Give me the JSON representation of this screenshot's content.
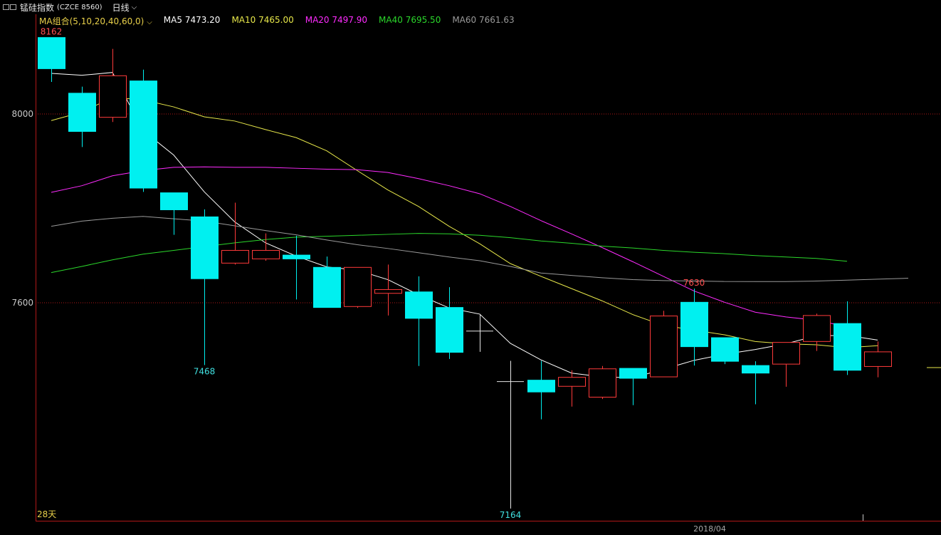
{
  "header": {
    "instrument": "锰硅指数",
    "code": "(CZCE 8560)",
    "period": "日线",
    "ma_group_label": "MA组合(5,10,20,40,60,0)",
    "ma_values": [
      {
        "name": "MA5",
        "value": "7473.20",
        "color": "#ffffff"
      },
      {
        "name": "MA10",
        "value": "7465.00",
        "color": "#e8e84a"
      },
      {
        "name": "MA20",
        "value": "7497.90",
        "color": "#ff2bff"
      },
      {
        "name": "MA40",
        "value": "7695.50",
        "color": "#2bd82b"
      },
      {
        "name": "MA60",
        "value": "7661.63",
        "color": "#9a9a9a"
      }
    ]
  },
  "footer": {
    "days_label": "28天",
    "date_label": "2018/04"
  },
  "colors": {
    "up": "#ff3a3a",
    "down": "#00f0f0",
    "grid": "#b01818",
    "axis": "#b01818"
  },
  "chart_data": {
    "type": "candlestick",
    "ylim": [
      7160,
      8260
    ],
    "yticks": [
      8000,
      7600
    ],
    "annotations": [
      {
        "text": "8162",
        "index": 0,
        "price": 8162,
        "color": "#ff5050",
        "pos": "above"
      },
      {
        "text": "7468",
        "index": 5,
        "price": 7468,
        "color": "#40e0e0",
        "pos": "below"
      },
      {
        "text": "7164",
        "index": 15,
        "price": 7164,
        "color": "#40e0e0",
        "pos": "below"
      },
      {
        "text": "7630",
        "index": 21,
        "price": 7630,
        "color": "#ff5050",
        "pos": "above"
      }
    ],
    "candles": [
      {
        "o": 8162,
        "h": 8162,
        "l": 8068,
        "c": 8096
      },
      {
        "o": 8044,
        "h": 8058,
        "l": 7930,
        "c": 7963
      },
      {
        "o": 7993,
        "h": 8138,
        "l": 7983,
        "c": 8081
      },
      {
        "o": 8070,
        "h": 8094,
        "l": 7835,
        "c": 7843
      },
      {
        "o": 7833,
        "h": 7808,
        "l": 7744,
        "c": 7797
      },
      {
        "o": 7782,
        "h": 7798,
        "l": 7468,
        "c": 7651
      },
      {
        "o": 7684,
        "h": 7812,
        "l": 7681,
        "c": 7711
      },
      {
        "o": 7693,
        "h": 7747,
        "l": 7689,
        "c": 7711
      },
      {
        "o": 7701,
        "h": 7742,
        "l": 7607,
        "c": 7693
      },
      {
        "o": 7675,
        "h": 7698,
        "l": 7590,
        "c": 7590
      },
      {
        "o": 7592,
        "h": 7675,
        "l": 7589,
        "c": 7675
      },
      {
        "o": 7620,
        "h": 7681,
        "l": 7573,
        "c": 7628
      },
      {
        "o": 7623,
        "h": 7656,
        "l": 7466,
        "c": 7567
      },
      {
        "o": 7590,
        "h": 7633,
        "l": 7481,
        "c": 7495
      },
      {
        "o": 7540,
        "h": 7575,
        "l": 7496,
        "c": 7540
      },
      {
        "o": 7433,
        "h": 7477,
        "l": 7164,
        "c": 7433
      },
      {
        "o": 7436,
        "h": 7477,
        "l": 7353,
        "c": 7411
      },
      {
        "o": 7423,
        "h": 7457,
        "l": 7380,
        "c": 7442
      },
      {
        "o": 7400,
        "h": 7466,
        "l": 7396,
        "c": 7460
      },
      {
        "o": 7461,
        "h": 7459,
        "l": 7383,
        "c": 7440
      },
      {
        "o": 7443,
        "h": 7583,
        "l": 7443,
        "c": 7572
      },
      {
        "o": 7601,
        "h": 7630,
        "l": 7467,
        "c": 7507
      },
      {
        "o": 7526,
        "h": 7523,
        "l": 7470,
        "c": 7476
      },
      {
        "o": 7467,
        "h": 7476,
        "l": 7385,
        "c": 7451
      },
      {
        "o": 7470,
        "h": 7515,
        "l": 7422,
        "c": 7516
      },
      {
        "o": 7518,
        "h": 7577,
        "l": 7498,
        "c": 7573
      },
      {
        "o": 7556,
        "h": 7603,
        "l": 7447,
        "c": 7457
      },
      {
        "o": 7465,
        "h": 7518,
        "l": 7442,
        "c": 7496
      }
    ],
    "series": [
      {
        "name": "MA5",
        "color": "#ffffff",
        "values": [
          8086,
          8082,
          8088,
          7965,
          7913,
          7835,
          7771,
          7727,
          7699,
          7676,
          7669,
          7649,
          7617,
          7589,
          7576,
          7514,
          7479,
          7451,
          7443,
          7441,
          7459,
          7478,
          7491,
          7501,
          7513,
          7530,
          7531,
          7521
        ]
      },
      {
        "name": "MA10",
        "color": "#e8e84a",
        "values": [
          7986,
          8004,
          8035,
          8030,
          8015,
          7994,
          7985,
          7967,
          7950,
          7922,
          7880,
          7839,
          7804,
          7762,
          7725,
          7683,
          7656,
          7630,
          7604,
          7575,
          7552,
          7542,
          7532,
          7518,
          7513,
          7511,
          7505,
          7509
        ]
      },
      {
        "name": "MA20",
        "color": "#ff2bff",
        "values": [
          7834,
          7848,
          7869,
          7880,
          7887,
          7888,
          7887,
          7887,
          7885,
          7883,
          7882,
          7876,
          7863,
          7848,
          7831,
          7804,
          7774,
          7746,
          7717,
          7687,
          7656,
          7625,
          7601,
          7580,
          7570,
          7563,
          7549
        ]
      },
      {
        "name": "MA40",
        "color": "#2bd82b",
        "values": [
          7664,
          7677,
          7691,
          7703,
          7711,
          7719,
          7727,
          7734,
          7739,
          7741,
          7743,
          7745,
          7747,
          7746,
          7743,
          7738,
          7731,
          7726,
          7720,
          7716,
          7711,
          7707,
          7704,
          7700,
          7697,
          7694,
          7688
        ]
      },
      {
        "name": "MA60",
        "color": "#9a9a9a",
        "values": [
          7762,
          7773,
          7779,
          7783,
          7778,
          7773,
          7763,
          7753,
          7744,
          7733,
          7723,
          7715,
          7706,
          7697,
          7689,
          7677,
          7663,
          7658,
          7653,
          7649,
          7647,
          7646,
          7645,
          7645,
          7645,
          7646,
          7648,
          7650,
          7652
        ]
      }
    ]
  }
}
